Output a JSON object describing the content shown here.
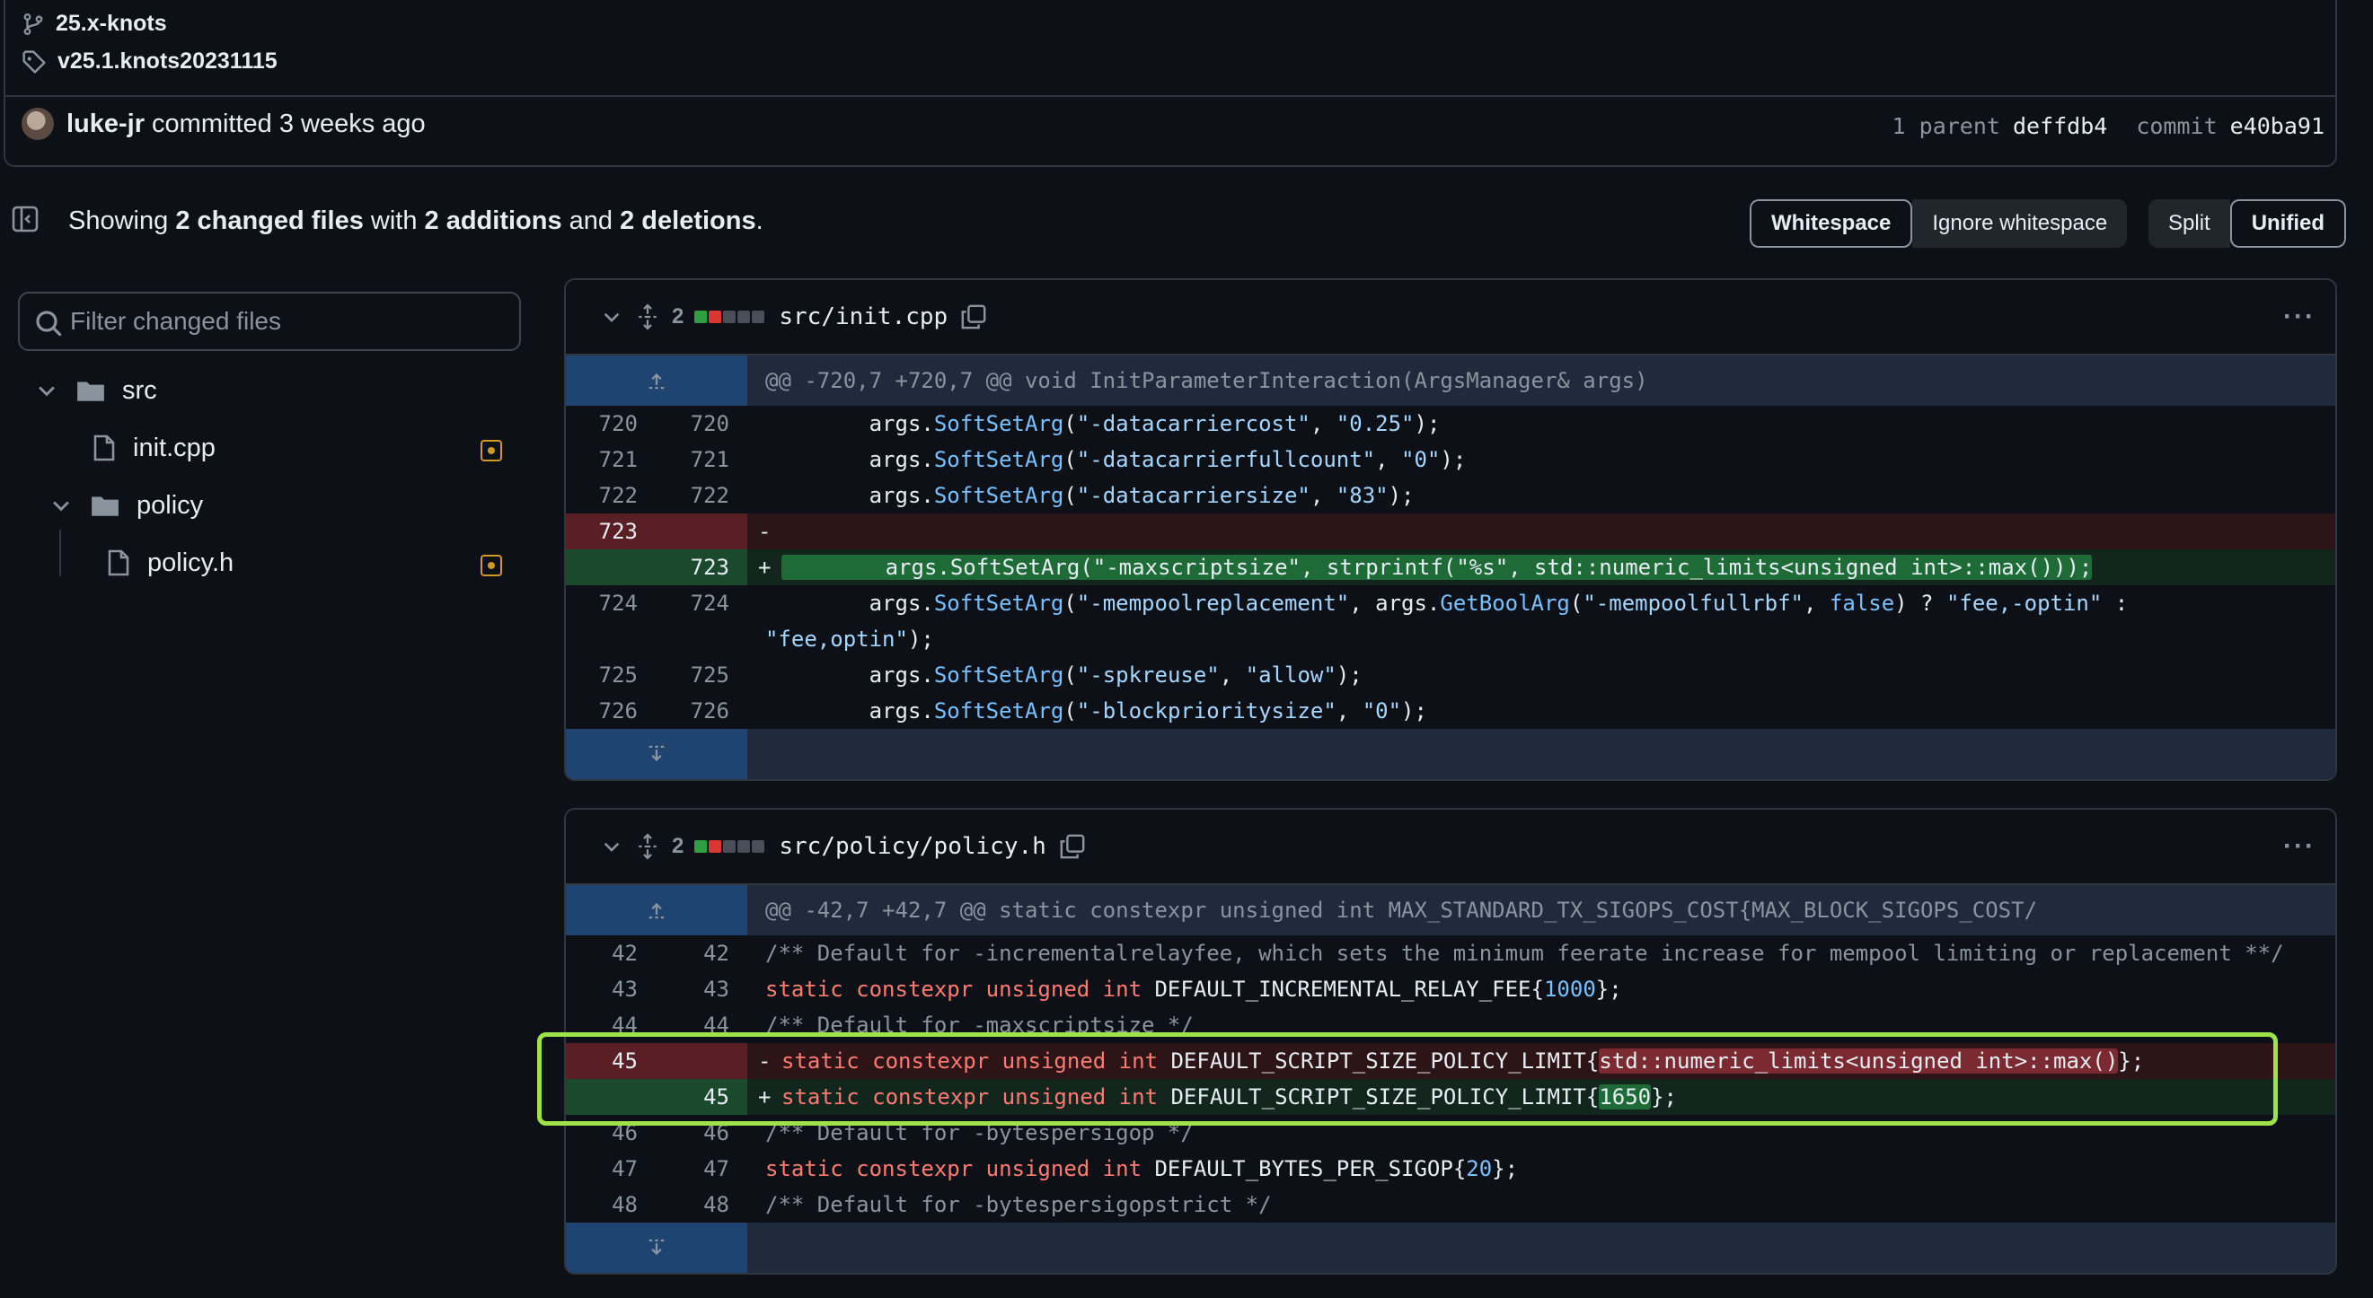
{
  "refs": {
    "branch": "25.x-knots",
    "tag": "v25.1.knots20231115"
  },
  "commit": {
    "author": "luke-jr",
    "action_text": "committed 3 weeks ago",
    "parent_label": "1 parent",
    "parent_sha": "deffdb4",
    "commit_label": "commit",
    "commit_sha": "e40ba91"
  },
  "summary": {
    "prefix": "Showing",
    "files": "2 changed files",
    "with": "with",
    "additions": "2 additions",
    "and": "and",
    "deletions": "2 deletions",
    "suffix": "."
  },
  "toolbar": {
    "whitespace": "Whitespace",
    "ignore_whitespace": "Ignore whitespace",
    "split": "Split",
    "unified": "Unified"
  },
  "filter": {
    "placeholder": "Filter changed files"
  },
  "tree": {
    "src": "src",
    "init": "init.cpp",
    "policy_dir": "policy",
    "policy_h": "policy.h"
  },
  "files": [
    {
      "count": "2",
      "path": "src/init.cpp",
      "hunk": "@@ -720,7 +720,7 @@ void InitParameterInteraction(ArgsManager& args)"
    },
    {
      "count": "2",
      "path": "src/policy/policy.h",
      "hunk": "@@ -42,7 +42,7 @@ static constexpr unsigned int MAX_STANDARD_TX_SIGOPS_COST{MAX_BLOCK_SIGOPS_COST/"
    }
  ],
  "lines": {
    "l720": "720",
    "l721": "721",
    "l722": "722",
    "l723": "723",
    "l724": "724",
    "l725": "725",
    "l726": "726",
    "l42": "42",
    "l43": "43",
    "l44": "44",
    "l45": "45",
    "l46": "46",
    "l47": "47",
    "l48": "48"
  },
  "colors": {
    "add": "#2ea043",
    "del": "#da3633",
    "accent": "#9ee34a"
  }
}
